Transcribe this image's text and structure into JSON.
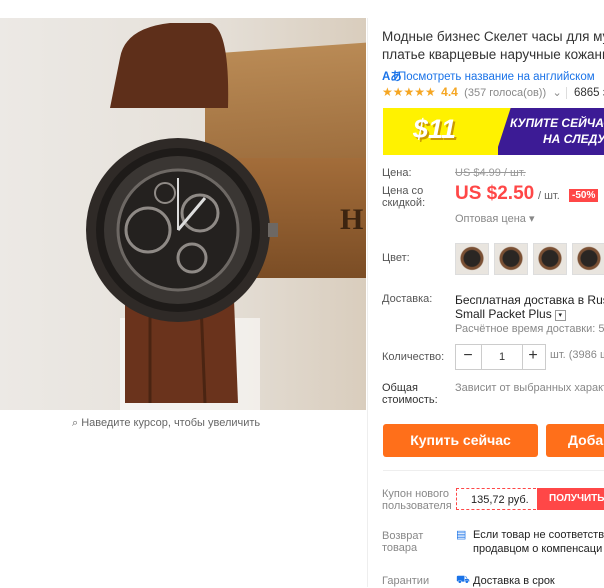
{
  "gallery": {
    "zoom_hint": "Наведите курсор, чтобы увеличить"
  },
  "product": {
    "title_line1": "Модные бизнес Скелет часы для муж",
    "title_line2": "платье кварцевые наручные кожань",
    "translate_link": "Посмотреть название на английском",
    "stars": "★★★★★",
    "rating": "4.4",
    "votes": "(357 голоса(ов))",
    "orders": "6865 за"
  },
  "banner": {
    "amount": "$11",
    "line1": "КУПИТЕ СЕЙЧАС",
    "line2": "НА СЛЕДУ"
  },
  "price": {
    "label": "Цена:",
    "old": "US $4.99 / шт.",
    "discount_label_1": "Цена со",
    "discount_label_2": "скидкой:",
    "current": "US $2.50",
    "unit": "/ шт.",
    "discount": "-50%",
    "wholesale": "Оптовая цена"
  },
  "color": {
    "label": "Цвет:",
    "swatches": 4
  },
  "shipping": {
    "label": "Доставка:",
    "line1": "Бесплатная доставка в Russ",
    "line2": "Small Packet Plus",
    "eta": "Расчётное время доставки: 52"
  },
  "quantity": {
    "label": "Количество:",
    "minus": "−",
    "value": "1",
    "plus": "+",
    "available": "шт. (3986 ш"
  },
  "total": {
    "label_1": "Общая",
    "label_2": "стоимость:",
    "text": "Зависит от выбранных характ"
  },
  "actions": {
    "buy_now": "Купить сейчас",
    "add": "Доба"
  },
  "coupon": {
    "label_1": "Купон нового",
    "label_2": "пользователя",
    "value": "135,72 руб.",
    "button": "ПОЛУЧИТЬ"
  },
  "returns": {
    "label_1": "Возврат",
    "label_2": "товара",
    "line1": "Если товар не соответству",
    "line2": "продавцом о компенсаци"
  },
  "guarantee": {
    "label": "Гарантии",
    "text": "Доставка в срок"
  },
  "colors": {
    "accent": "#ff4747",
    "button": "#ff6f1a",
    "link": "#1a73e8",
    "star": "#f5a623",
    "banner_purple": "#3c1b95",
    "banner_yellow": "#fff200"
  }
}
